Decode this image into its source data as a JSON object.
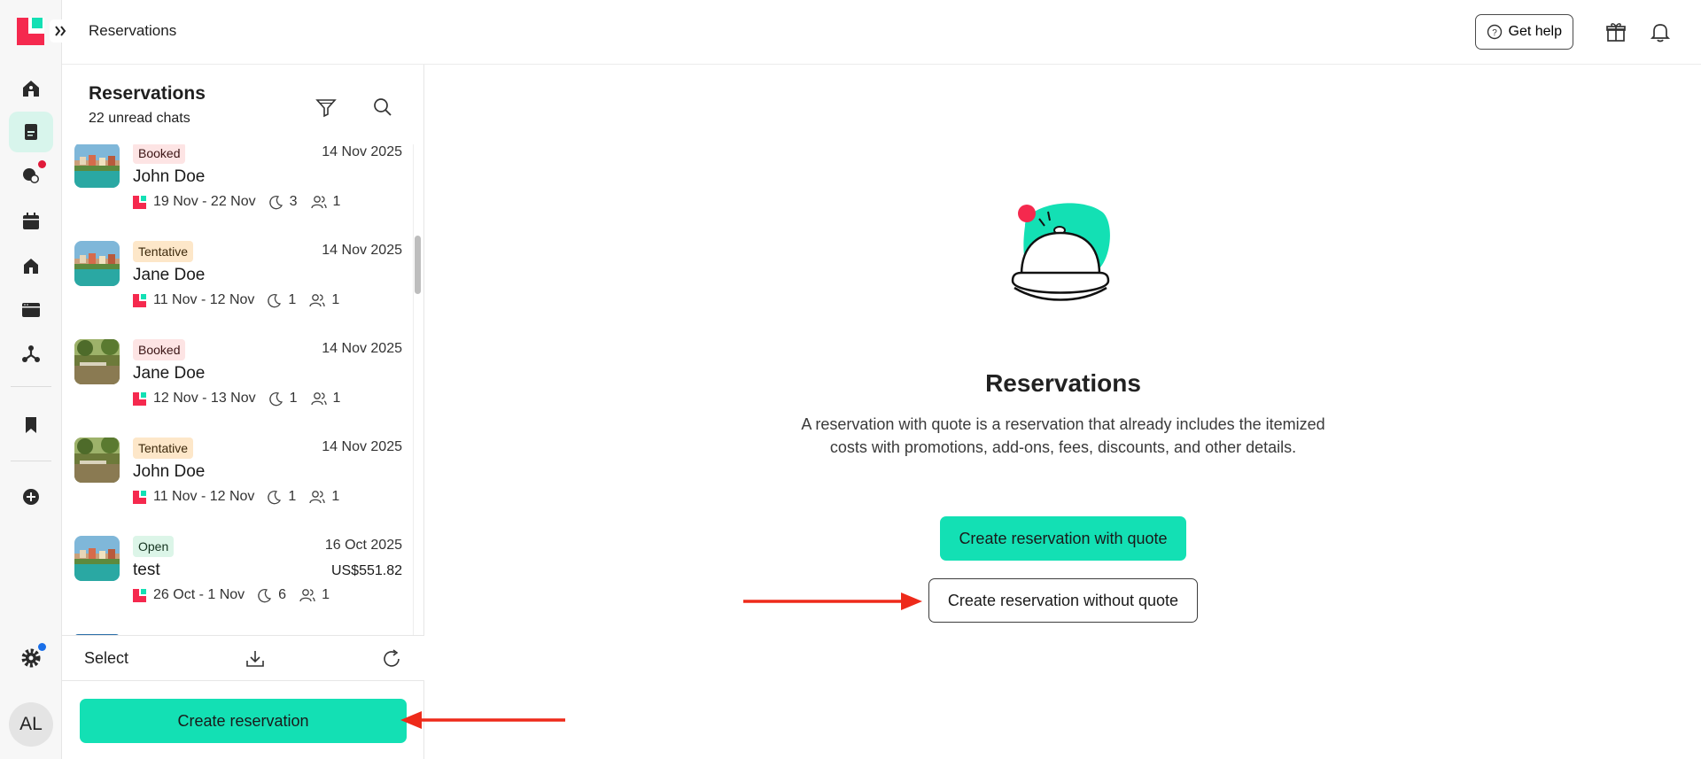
{
  "app": {
    "page_title": "Reservations",
    "brand_color": "#f5294e",
    "accent_color": "#13e0b4"
  },
  "sidebar": {
    "items": [
      {
        "name": "home-icon",
        "active": false
      },
      {
        "name": "reservations-icon",
        "active": true
      },
      {
        "name": "inbox-icon",
        "active": false,
        "notification": true
      },
      {
        "name": "calendar-icon",
        "active": false
      },
      {
        "name": "properties-icon",
        "active": false
      },
      {
        "name": "channels-icon",
        "active": false
      },
      {
        "name": "integrations-icon",
        "active": false
      },
      {
        "name": "bookmark-icon",
        "active": false
      },
      {
        "name": "add-icon",
        "active": false
      },
      {
        "name": "settings-icon",
        "active": false,
        "notification": true
      }
    ],
    "avatar_initials": "AL"
  },
  "topbar": {
    "title": "Reservations",
    "help_label": "Get help",
    "icons": [
      "gift-icon",
      "bell-icon"
    ]
  },
  "panel": {
    "title": "Reservations",
    "subtitle": "22 unread chats",
    "items": [
      {
        "status": "Booked",
        "status_type": "booked",
        "date": "14 Nov 2025",
        "name": "John Doe",
        "range": "19 Nov - 22 Nov",
        "nights": "3",
        "guests": "1",
        "price": ""
      },
      {
        "status": "Tentative",
        "status_type": "tentative",
        "date": "14 Nov 2025",
        "name": "Jane Doe",
        "range": "11 Nov - 12 Nov",
        "nights": "1",
        "guests": "1",
        "price": ""
      },
      {
        "status": "Booked",
        "status_type": "booked",
        "date": "14 Nov 2025",
        "name": "Jane Doe",
        "range": "12 Nov - 13 Nov",
        "nights": "1",
        "guests": "1",
        "price": ""
      },
      {
        "status": "Tentative",
        "status_type": "tentative",
        "date": "14 Nov 2025",
        "name": "John Doe",
        "range": "11 Nov - 12 Nov",
        "nights": "1",
        "guests": "1",
        "price": ""
      },
      {
        "status": "Open",
        "status_type": "open",
        "date": "16 Oct 2025",
        "name": "test",
        "range": "26 Oct - 1 Nov",
        "nights": "6",
        "guests": "1",
        "price": "US$551.82"
      }
    ],
    "select_label": "Select",
    "create_label": "Create reservation"
  },
  "main": {
    "title": "Reservations",
    "description": "A reservation with quote is a reservation that already includes the itemized costs with promotions, add-ons, fees, discounts, and other details.",
    "btn_with_quote": "Create reservation with quote",
    "btn_without_quote": "Create reservation without quote"
  }
}
